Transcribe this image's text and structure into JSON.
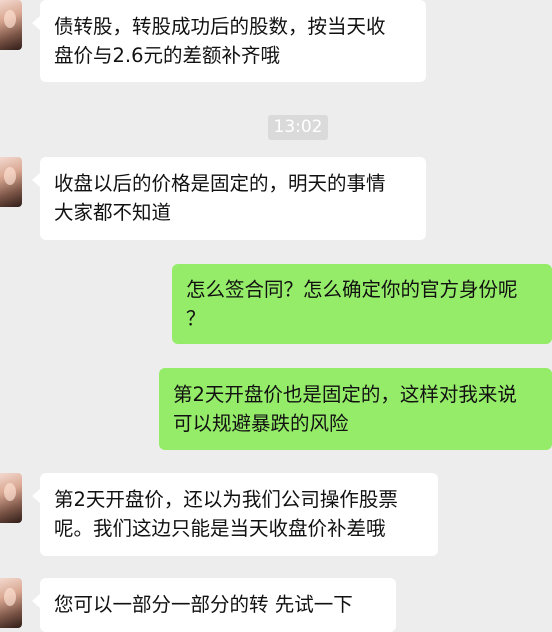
{
  "messages": [
    {
      "side": "in",
      "lines": [
        "债转股，转股成功后的股数，按当天收",
        "盘价与2.6元的差额补齐哦"
      ]
    },
    {
      "type": "time",
      "text": "13:02"
    },
    {
      "side": "in",
      "lines": [
        "收盘以后的价格是固定的，明天的事情",
        "大家都不知道"
      ]
    },
    {
      "side": "out",
      "lines": [
        "怎么签合同？怎么确定你的官方身份呢",
        "？"
      ]
    },
    {
      "side": "out",
      "lines": [
        "第2天开盘价也是固定的，这样对我来说",
        "可以规避暴跌的风险"
      ]
    },
    {
      "side": "in",
      "lines": [
        "第2天开盘价，还以为我们公司操作股票",
        "呢。我们这边只能是当天收盘价补差哦"
      ]
    },
    {
      "side": "in",
      "lines": [
        "您可以一部分一部分的转 先试一下"
      ]
    }
  ]
}
